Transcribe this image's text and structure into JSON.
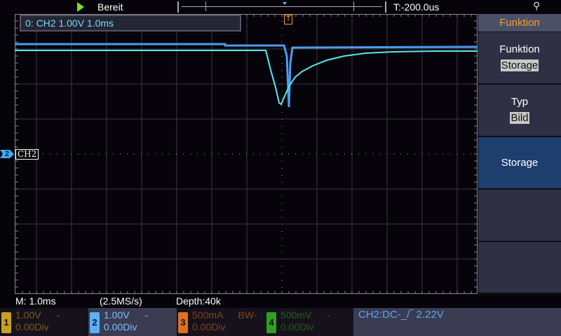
{
  "top": {
    "status": "Bereit",
    "trigger_time": "T:-200.0us",
    "usb_icon": "usb-icon"
  },
  "overlay": {
    "channel_info": "0: CH2  1.00V  1.0ms",
    "ch2_tag": "CH2",
    "ch2_marker": "2",
    "trigger_marker": "T"
  },
  "panel": {
    "header": "Funktion",
    "items": [
      {
        "label": "Funktion",
        "value": "Storage"
      },
      {
        "label": "Typ",
        "value": "Bild"
      },
      {
        "label": "Storage"
      }
    ]
  },
  "info": {
    "timebase": "M: 1.0ms",
    "sample_rate": "(2.5MS/s)",
    "depth": "Depth:40k"
  },
  "channels": [
    {
      "num": "1",
      "scale": "1.00V",
      "extra": "-",
      "offset": "0.00Div",
      "color": "#c8a020"
    },
    {
      "num": "2",
      "scale": "1.00V",
      "extra": "-",
      "offset": "0.00Div",
      "color": "#5ab0ff"
    },
    {
      "num": "3",
      "scale": "500mA",
      "extra": "BW-",
      "offset": "0.00Div",
      "color": "#e07020"
    },
    {
      "num": "4",
      "scale": "500mV",
      "extra": "-",
      "offset": "0.00Div",
      "color": "#30a020"
    }
  ],
  "trigger": {
    "text": "CH2:DC-_/‾ 2.22V"
  }
}
